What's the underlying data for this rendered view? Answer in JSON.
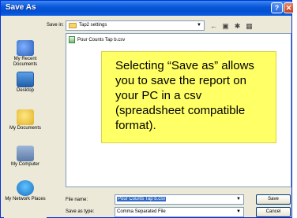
{
  "window": {
    "title": "Save As",
    "help_glyph": "?",
    "close_glyph": "✕"
  },
  "header": {
    "savein_label": "Save in:",
    "savein_value": "Tap2 settings"
  },
  "toolbar": {
    "icons": [
      "back-icon",
      "up-folder-icon",
      "new-folder-icon",
      "views-menu-icon"
    ]
  },
  "places": [
    {
      "label": "My Recent Documents",
      "icon": "recent-documents-icon"
    },
    {
      "label": "Desktop",
      "icon": "desktop-icon"
    },
    {
      "label": "My Documents",
      "icon": "my-documents-icon"
    },
    {
      "label": "My Computer",
      "icon": "my-computer-icon"
    },
    {
      "label": "My Network Places",
      "icon": "network-places-icon"
    }
  ],
  "files": [
    {
      "name": "Pour Counts Tap b.csv"
    }
  ],
  "callout": {
    "text": "Selecting “Save as” allows you to save the report on your PC in a csv (spreadsheet compatible format)."
  },
  "form": {
    "filename_label": "File name:",
    "filename_value": "Pour Counts Tap b.csv",
    "savetype_label": "Save as type:",
    "savetype_value": "Comma Separated File"
  },
  "buttons": {
    "save": "Save",
    "cancel": "Cancel"
  },
  "colors": {
    "titlebar": "#0550d2",
    "callout": "#ffff66",
    "selection": "#316ac5"
  }
}
